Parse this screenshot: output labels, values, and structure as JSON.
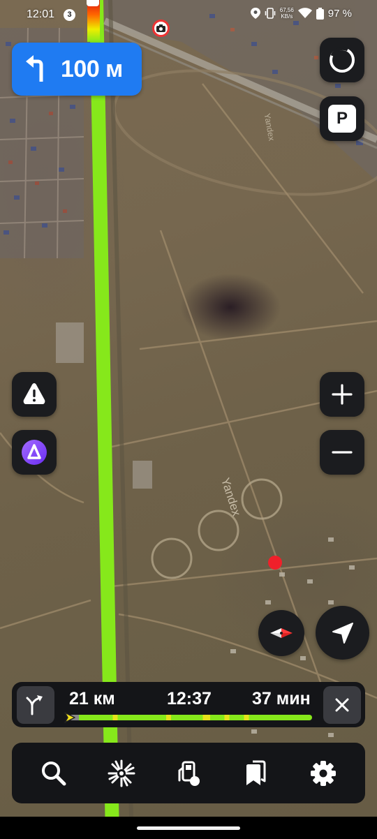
{
  "status_bar": {
    "time": "12:01",
    "notification_count": "3",
    "net_speed_value": "67,56",
    "net_speed_unit": "KB/s",
    "battery": "97 %"
  },
  "maneuver": {
    "direction_icon": "turn-left-arrow-icon",
    "distance": "100 м"
  },
  "map": {
    "labels": [
      "Yandex",
      "Yandex"
    ],
    "route_color": "#86e81b",
    "maneuver_color": "#1f7bf2"
  },
  "trip": {
    "distance": "21 км",
    "arrival_time": "12:37",
    "duration": "37 мин"
  },
  "buttons": {
    "parking_label": "P"
  },
  "toolbar": {
    "items": [
      "search-icon",
      "discovery-icon",
      "gas-station-icon",
      "bookmarks-icon",
      "settings-icon"
    ]
  }
}
